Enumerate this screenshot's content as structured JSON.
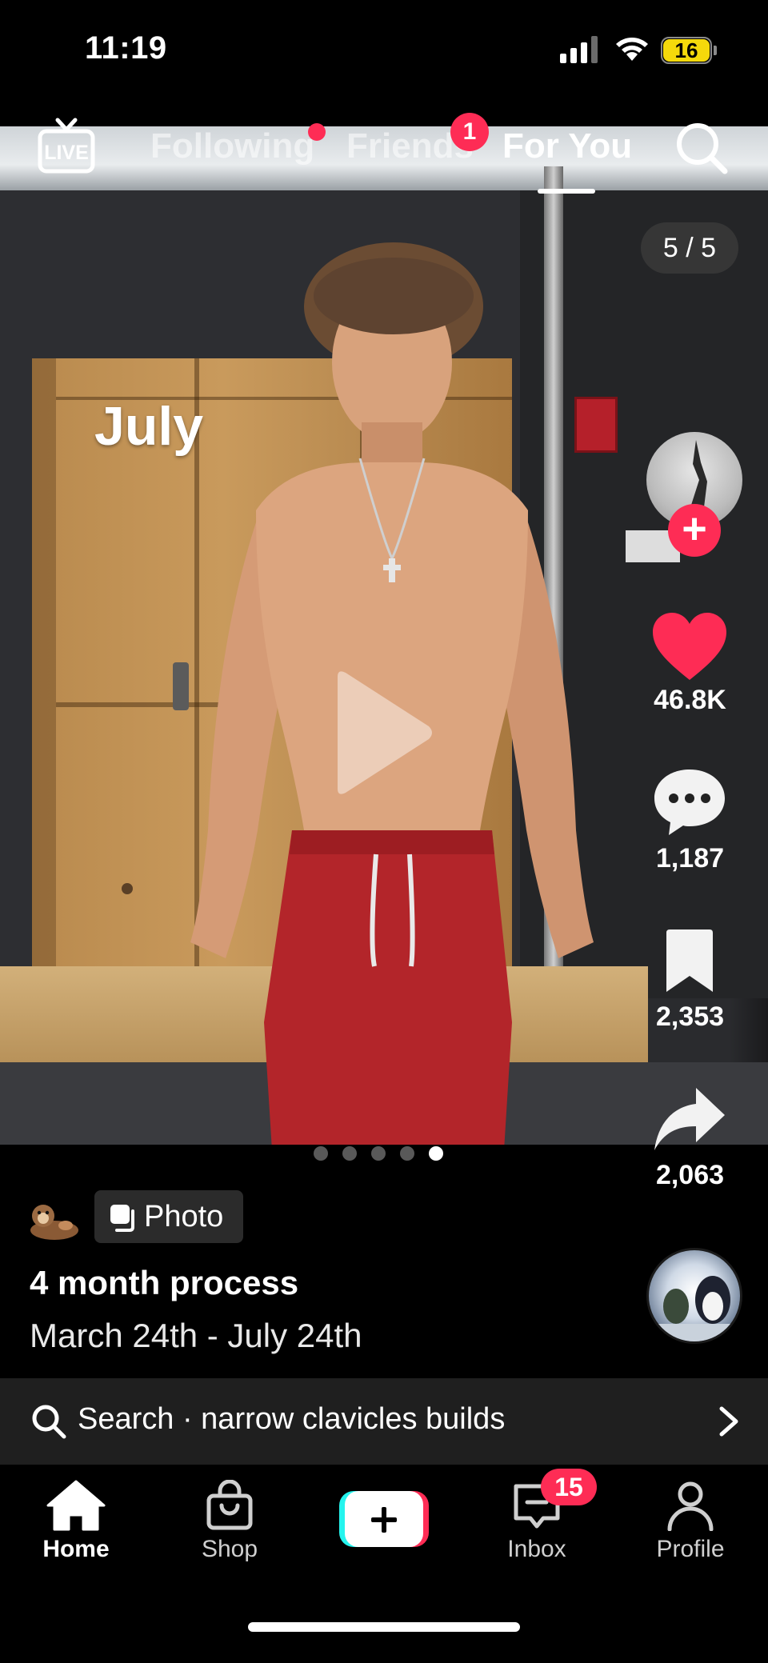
{
  "status_bar": {
    "time": "11:19",
    "battery": "16",
    "battery_color": "#f5d90b"
  },
  "top_nav": {
    "live_label": "LIVE",
    "tabs": [
      {
        "label": "Following",
        "active": false,
        "has_dot": true
      },
      {
        "label": "Friends",
        "active": false,
        "badge": "1"
      },
      {
        "label": "For You",
        "active": true
      }
    ],
    "search_icon": "search-icon"
  },
  "post": {
    "overlay_text": "July",
    "photo_counter": "5 / 5",
    "total_photos": 5,
    "current_photo": 5,
    "type_label": "Photo",
    "title": "4 month process",
    "subtitle": "March 24th - July 24th"
  },
  "actions": {
    "likes": "46.8K",
    "comments": "1,187",
    "bookmarks": "2,353",
    "shares": "2,063",
    "like_color": "#fe2c55"
  },
  "search_suggestion": {
    "text": "Search · narrow clavicles builds"
  },
  "bottom_tabs": {
    "home": "Home",
    "shop": "Shop",
    "inbox": "Inbox",
    "inbox_badge": "15",
    "profile": "Profile"
  },
  "accent_color": "#fe2c55"
}
